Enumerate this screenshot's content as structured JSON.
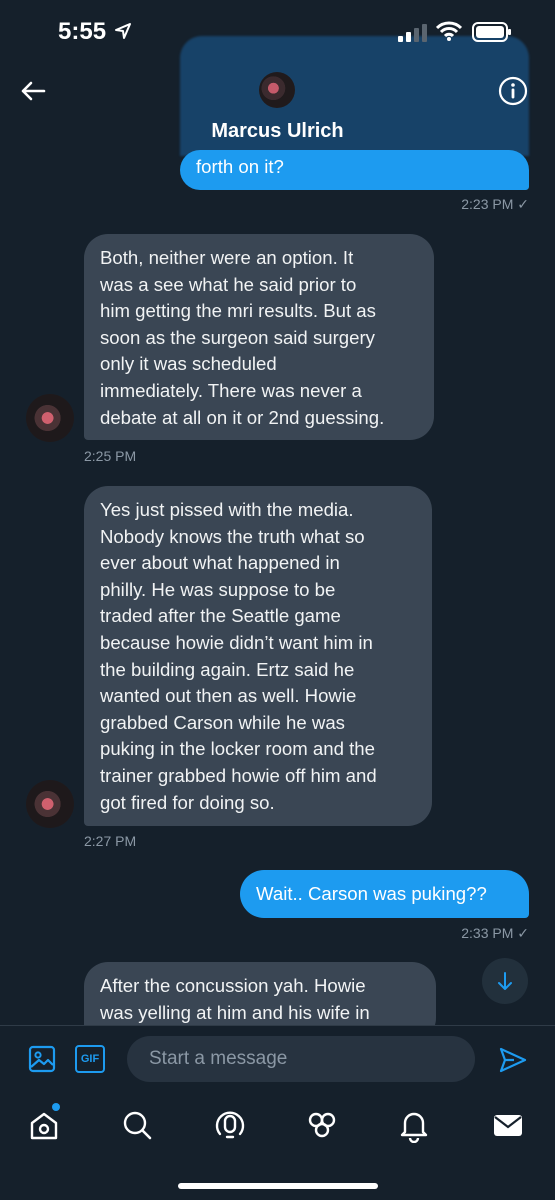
{
  "status_bar": {
    "time": "5:55"
  },
  "header": {
    "contact_name": "Marcus Ulrich"
  },
  "messages": [
    {
      "direction": "out",
      "text": "forth on it?",
      "time": "2:23 PM ✓"
    },
    {
      "direction": "in",
      "lines": [
        "Both, neither were an option. It",
        "was a see what he said prior to",
        "him getting the mri results. But as",
        "soon as the surgeon said surgery",
        "only it was scheduled",
        "immediately. There was never a",
        "debate at all on it or 2nd guessing."
      ],
      "time": "2:25 PM"
    },
    {
      "direction": "in",
      "lines": [
        "Yes just pissed with the media.",
        "Nobody knows the truth what so",
        "ever about what happened in",
        "philly. He was suppose to be",
        "traded after the Seattle game",
        "because howie didn’t want him in",
        "the building again. Ertz said he",
        "wanted out then as well. Howie",
        "grabbed Carson while he was",
        "puking in the locker room and the",
        "trainer grabbed howie off him and",
        "got fired for doing so."
      ],
      "time": "2:27 PM"
    },
    {
      "direction": "out",
      "text": "Wait.. Carson was puking??",
      "time": "2:33 PM ✓"
    },
    {
      "direction": "in",
      "lines": [
        "After the concussion yah. Howie",
        "was yelling at him and his wife in"
      ]
    }
  ],
  "composer": {
    "placeholder": "Start a message",
    "gif_label": "GIF"
  },
  "tabs": [
    "home-icon",
    "search-icon",
    "spaces-icon",
    "communities-icon",
    "notifications-icon",
    "messages-icon"
  ],
  "colors": {
    "background": "#15202b",
    "accent": "#1d9bf0",
    "incoming_bubble": "#3a4654"
  }
}
